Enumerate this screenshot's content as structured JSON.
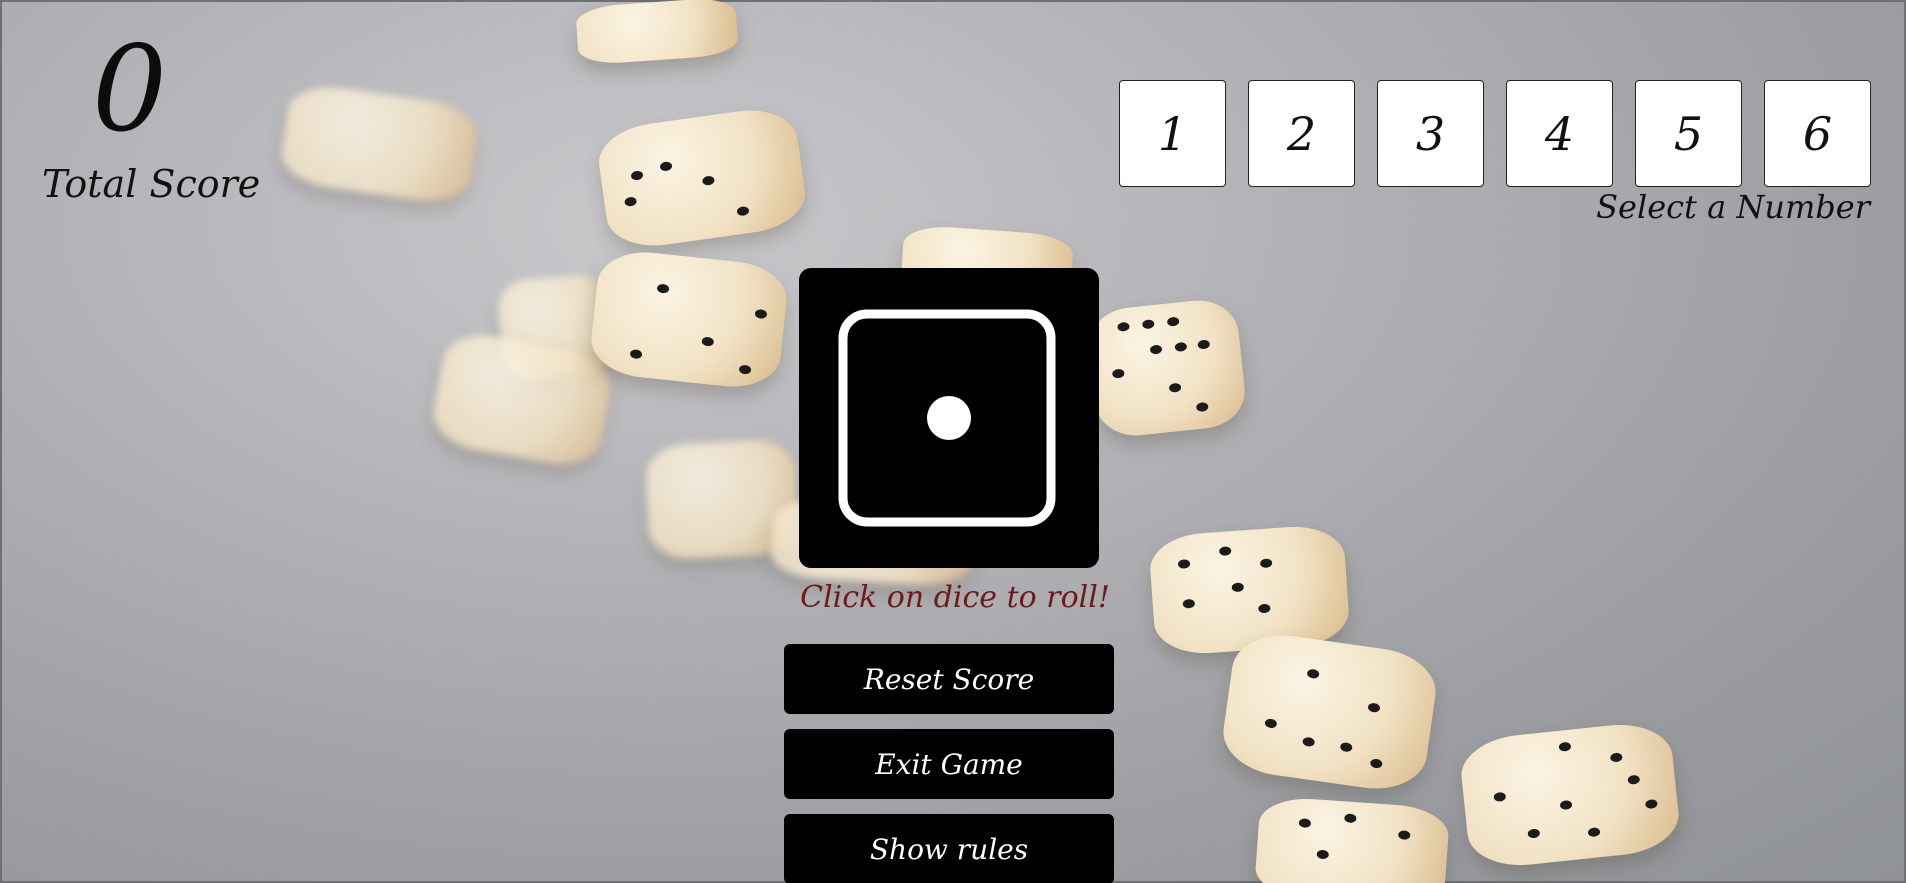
{
  "score": {
    "value": "0",
    "label": "Total Score"
  },
  "number_select": {
    "options": [
      "1",
      "2",
      "3",
      "4",
      "5",
      "6"
    ],
    "label": "Select a Number"
  },
  "dice": {
    "current_face": 1,
    "icon": "dice-face-one-icon"
  },
  "hint": "Click on dice to roll!",
  "buttons": {
    "reset": "Reset Score",
    "exit": "Exit Game",
    "rules": "Show rules"
  }
}
